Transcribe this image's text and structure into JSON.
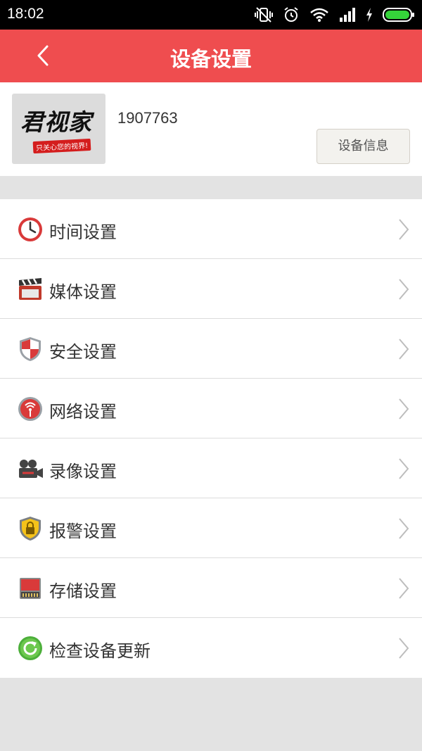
{
  "status_bar": {
    "time": "18:02",
    "icons": [
      "vibrate-off-icon",
      "alarm-icon",
      "wifi-icon",
      "signal-icon",
      "charging-icon",
      "battery-icon"
    ]
  },
  "header": {
    "title": "设备设置",
    "back_icon": "chevron-left-icon",
    "background_color": "#ef4d4f"
  },
  "device": {
    "logo_text": "君视家",
    "logo_tagline": "只关心您的视界!",
    "id": "1907763",
    "info_button_label": "设备信息"
  },
  "menu": {
    "items": [
      {
        "label": "时间设置",
        "icon": "clock-icon"
      },
      {
        "label": "媒体设置",
        "icon": "clapperboard-icon"
      },
      {
        "label": "安全设置",
        "icon": "shield-icon"
      },
      {
        "label": "网络设置",
        "icon": "network-icon"
      },
      {
        "label": "录像设置",
        "icon": "video-camera-icon"
      },
      {
        "label": "报警设置",
        "icon": "lock-shield-icon"
      },
      {
        "label": "存储设置",
        "icon": "sd-card-icon"
      },
      {
        "label": "检查设备更新",
        "icon": "refresh-icon"
      }
    ]
  }
}
